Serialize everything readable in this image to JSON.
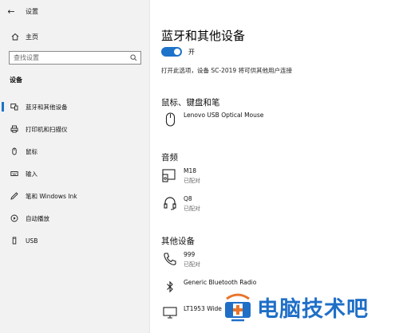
{
  "window": {
    "title": "设置",
    "back_glyph": "←"
  },
  "sidebar": {
    "home_label": "主页",
    "search_placeholder": "查找设置",
    "section_label": "设备",
    "items": [
      {
        "label": "蓝牙和其他设备",
        "icon": "bluetooth-devices-icon",
        "active": true
      },
      {
        "label": "打印机和扫描仪",
        "icon": "printer-icon"
      },
      {
        "label": "鼠标",
        "icon": "mouse-icon"
      },
      {
        "label": "输入",
        "icon": "keyboard-icon"
      },
      {
        "label": "笔和 Windows Ink",
        "icon": "pen-icon"
      },
      {
        "label": "自动播放",
        "icon": "autoplay-icon"
      },
      {
        "label": "USB",
        "icon": "usb-icon"
      }
    ]
  },
  "main": {
    "title": "蓝牙和其他设备",
    "toggle_label": "开",
    "toggle_on": true,
    "description": "打开此选项，设备 SC-2019 将可供其他用户连接",
    "groups": [
      {
        "title": "鼠标、键盘和笔",
        "devices": [
          {
            "name": "Lenovo USB Optical Mouse",
            "status": "",
            "icon": "mouse-icon"
          }
        ]
      },
      {
        "title": "音频",
        "devices": [
          {
            "name": "M18",
            "status": "已配对",
            "icon": "speaker-phone-icon"
          },
          {
            "name": "Q8",
            "status": "已配对",
            "icon": "headset-icon"
          }
        ]
      },
      {
        "title": "其他设备",
        "devices": [
          {
            "name": "999",
            "status": "已配对",
            "icon": "phone-icon"
          },
          {
            "name": "Generic Bluetooth Radio",
            "status": "",
            "icon": "bluetooth-icon"
          },
          {
            "name": "LT1953 Wide",
            "status": "",
            "icon": "monitor-icon"
          }
        ]
      }
    ]
  },
  "watermark": {
    "text": "电脑技术吧",
    "color": "#1f6fc7",
    "accent": "#e8742a"
  },
  "colors": {
    "accent": "#1c73c9",
    "sidebar_bg": "#f2f2f2"
  }
}
